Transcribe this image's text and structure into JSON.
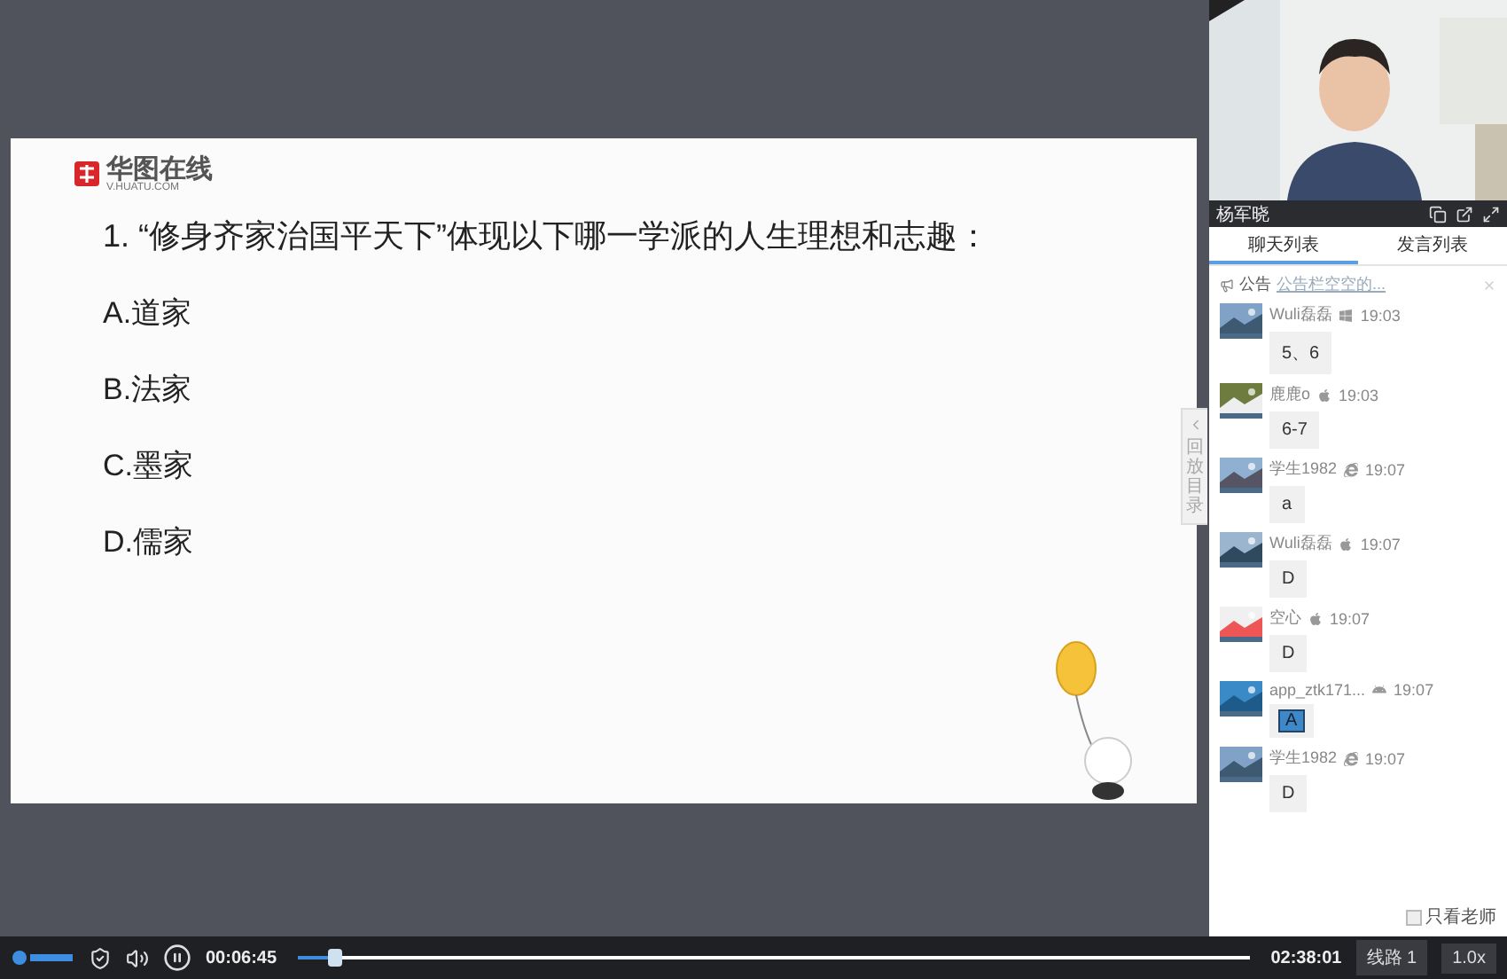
{
  "slide": {
    "logo": {
      "name": "华图在线",
      "domain": "V.HUATU.COM"
    },
    "question": "1. “修身齐家治国平天下”体现以下哪一学派的人生理想和志趣：",
    "options": [
      "A.道家",
      "B.法家",
      "C.墨家",
      "D.儒家"
    ],
    "side_tab": "回放目录"
  },
  "presenter": {
    "name": "杨军晓"
  },
  "chat": {
    "tabs": [
      {
        "label": "聊天列表",
        "selected": true
      },
      {
        "label": "发言列表",
        "selected": false
      }
    ],
    "notice": {
      "label": "公告",
      "text": "公告栏空空的..."
    },
    "messages": [
      {
        "user": "Wuli磊磊",
        "kind": "windows",
        "time": "19:03",
        "text": "5、6",
        "boxed": false
      },
      {
        "user": "鹿鹿o",
        "kind": "apple",
        "time": "19:03",
        "text": "6-7",
        "boxed": false
      },
      {
        "user": "学生1982",
        "kind": "ie",
        "time": "19:07",
        "text": "a",
        "boxed": false
      },
      {
        "user": "Wuli磊磊",
        "kind": "apple",
        "time": "19:07",
        "text": "D",
        "boxed": false
      },
      {
        "user": "空心",
        "kind": "apple",
        "time": "19:07",
        "text": "D",
        "boxed": false
      },
      {
        "user": "app_ztk171...",
        "kind": "android",
        "time": "19:07",
        "text": "A",
        "boxed": true
      },
      {
        "user": "学生1982",
        "kind": "ie",
        "time": "19:07",
        "text": "D",
        "boxed": false
      }
    ],
    "teacher_only": {
      "label": "只看老师",
      "checked": false
    }
  },
  "player": {
    "elapsed": "00:06:45",
    "total": "02:38:01",
    "level": 0.04,
    "line": "线路 1",
    "speed": "1.0x"
  }
}
